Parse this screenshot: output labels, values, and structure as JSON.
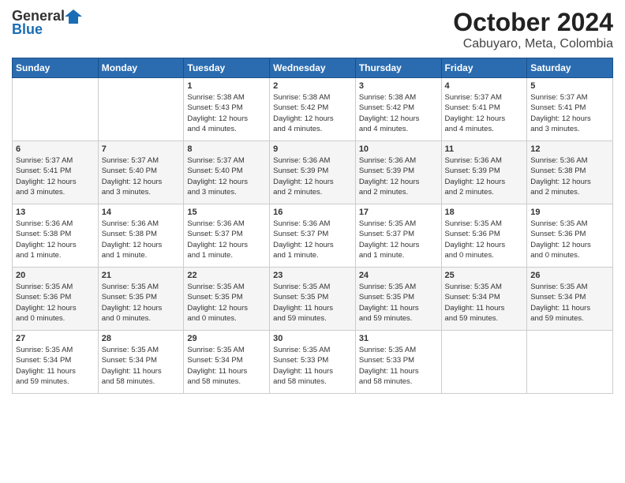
{
  "header": {
    "logo_general": "General",
    "logo_blue": "Blue",
    "title": "October 2024",
    "subtitle": "Cabuyaro, Meta, Colombia"
  },
  "weekdays": [
    "Sunday",
    "Monday",
    "Tuesday",
    "Wednesday",
    "Thursday",
    "Friday",
    "Saturday"
  ],
  "weeks": [
    [
      {
        "day": "",
        "info": ""
      },
      {
        "day": "",
        "info": ""
      },
      {
        "day": "1",
        "info": "Sunrise: 5:38 AM\nSunset: 5:43 PM\nDaylight: 12 hours\nand 4 minutes."
      },
      {
        "day": "2",
        "info": "Sunrise: 5:38 AM\nSunset: 5:42 PM\nDaylight: 12 hours\nand 4 minutes."
      },
      {
        "day": "3",
        "info": "Sunrise: 5:38 AM\nSunset: 5:42 PM\nDaylight: 12 hours\nand 4 minutes."
      },
      {
        "day": "4",
        "info": "Sunrise: 5:37 AM\nSunset: 5:41 PM\nDaylight: 12 hours\nand 4 minutes."
      },
      {
        "day": "5",
        "info": "Sunrise: 5:37 AM\nSunset: 5:41 PM\nDaylight: 12 hours\nand 3 minutes."
      }
    ],
    [
      {
        "day": "6",
        "info": "Sunrise: 5:37 AM\nSunset: 5:41 PM\nDaylight: 12 hours\nand 3 minutes."
      },
      {
        "day": "7",
        "info": "Sunrise: 5:37 AM\nSunset: 5:40 PM\nDaylight: 12 hours\nand 3 minutes."
      },
      {
        "day": "8",
        "info": "Sunrise: 5:37 AM\nSunset: 5:40 PM\nDaylight: 12 hours\nand 3 minutes."
      },
      {
        "day": "9",
        "info": "Sunrise: 5:36 AM\nSunset: 5:39 PM\nDaylight: 12 hours\nand 2 minutes."
      },
      {
        "day": "10",
        "info": "Sunrise: 5:36 AM\nSunset: 5:39 PM\nDaylight: 12 hours\nand 2 minutes."
      },
      {
        "day": "11",
        "info": "Sunrise: 5:36 AM\nSunset: 5:39 PM\nDaylight: 12 hours\nand 2 minutes."
      },
      {
        "day": "12",
        "info": "Sunrise: 5:36 AM\nSunset: 5:38 PM\nDaylight: 12 hours\nand 2 minutes."
      }
    ],
    [
      {
        "day": "13",
        "info": "Sunrise: 5:36 AM\nSunset: 5:38 PM\nDaylight: 12 hours\nand 1 minute."
      },
      {
        "day": "14",
        "info": "Sunrise: 5:36 AM\nSunset: 5:38 PM\nDaylight: 12 hours\nand 1 minute."
      },
      {
        "day": "15",
        "info": "Sunrise: 5:36 AM\nSunset: 5:37 PM\nDaylight: 12 hours\nand 1 minute."
      },
      {
        "day": "16",
        "info": "Sunrise: 5:36 AM\nSunset: 5:37 PM\nDaylight: 12 hours\nand 1 minute."
      },
      {
        "day": "17",
        "info": "Sunrise: 5:35 AM\nSunset: 5:37 PM\nDaylight: 12 hours\nand 1 minute."
      },
      {
        "day": "18",
        "info": "Sunrise: 5:35 AM\nSunset: 5:36 PM\nDaylight: 12 hours\nand 0 minutes."
      },
      {
        "day": "19",
        "info": "Sunrise: 5:35 AM\nSunset: 5:36 PM\nDaylight: 12 hours\nand 0 minutes."
      }
    ],
    [
      {
        "day": "20",
        "info": "Sunrise: 5:35 AM\nSunset: 5:36 PM\nDaylight: 12 hours\nand 0 minutes."
      },
      {
        "day": "21",
        "info": "Sunrise: 5:35 AM\nSunset: 5:35 PM\nDaylight: 12 hours\nand 0 minutes."
      },
      {
        "day": "22",
        "info": "Sunrise: 5:35 AM\nSunset: 5:35 PM\nDaylight: 12 hours\nand 0 minutes."
      },
      {
        "day": "23",
        "info": "Sunrise: 5:35 AM\nSunset: 5:35 PM\nDaylight: 11 hours\nand 59 minutes."
      },
      {
        "day": "24",
        "info": "Sunrise: 5:35 AM\nSunset: 5:35 PM\nDaylight: 11 hours\nand 59 minutes."
      },
      {
        "day": "25",
        "info": "Sunrise: 5:35 AM\nSunset: 5:34 PM\nDaylight: 11 hours\nand 59 minutes."
      },
      {
        "day": "26",
        "info": "Sunrise: 5:35 AM\nSunset: 5:34 PM\nDaylight: 11 hours\nand 59 minutes."
      }
    ],
    [
      {
        "day": "27",
        "info": "Sunrise: 5:35 AM\nSunset: 5:34 PM\nDaylight: 11 hours\nand 59 minutes."
      },
      {
        "day": "28",
        "info": "Sunrise: 5:35 AM\nSunset: 5:34 PM\nDaylight: 11 hours\nand 58 minutes."
      },
      {
        "day": "29",
        "info": "Sunrise: 5:35 AM\nSunset: 5:34 PM\nDaylight: 11 hours\nand 58 minutes."
      },
      {
        "day": "30",
        "info": "Sunrise: 5:35 AM\nSunset: 5:33 PM\nDaylight: 11 hours\nand 58 minutes."
      },
      {
        "day": "31",
        "info": "Sunrise: 5:35 AM\nSunset: 5:33 PM\nDaylight: 11 hours\nand 58 minutes."
      },
      {
        "day": "",
        "info": ""
      },
      {
        "day": "",
        "info": ""
      }
    ]
  ]
}
